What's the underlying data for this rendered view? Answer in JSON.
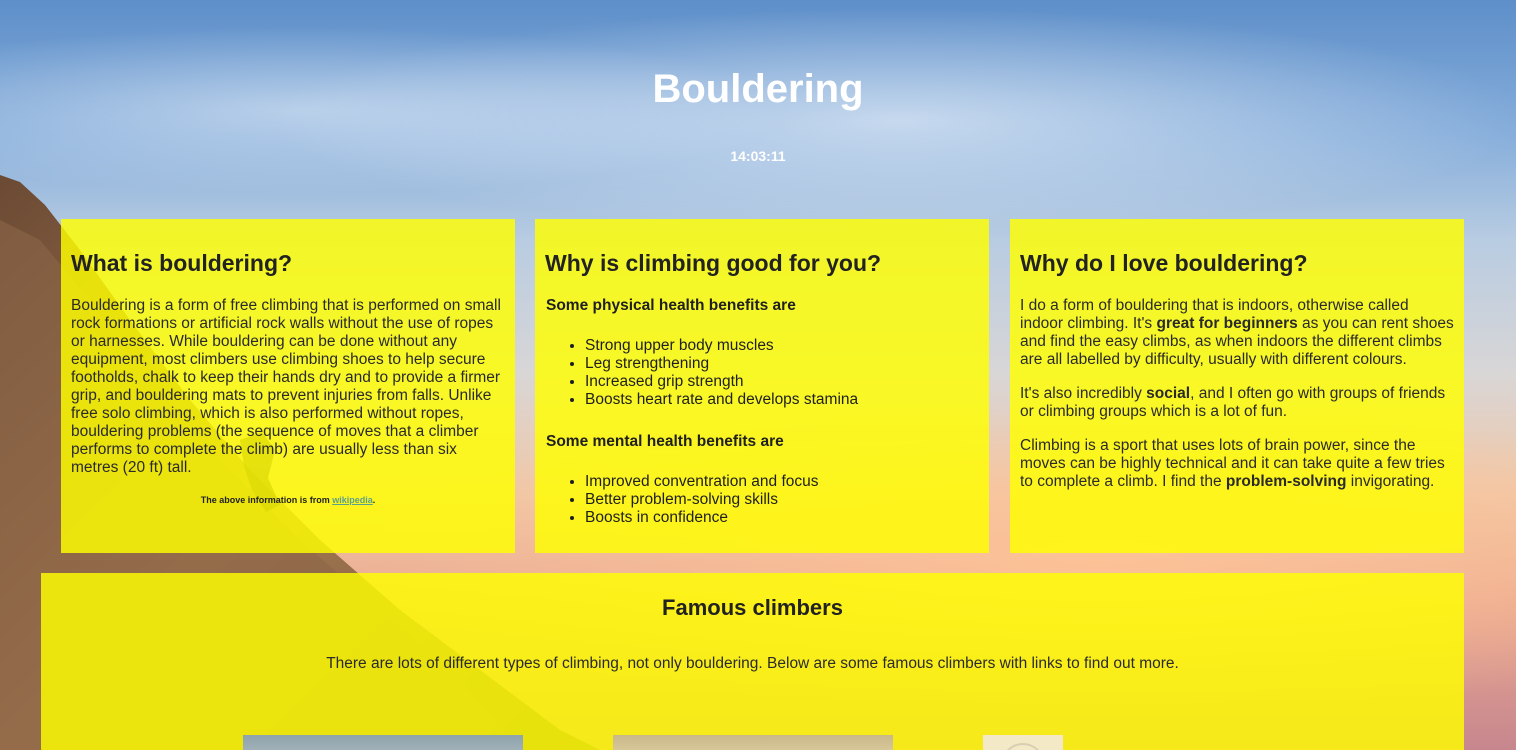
{
  "header": {
    "title": "Bouldering",
    "time": "14:03:11"
  },
  "cards": [
    {
      "heading": "What is bouldering?",
      "paragraph": "Bouldering is a form of free climbing that is performed on small rock formations or artificial rock walls without the use of ropes or harnesses. While bouldering can be done without any equipment, most climbers use climbing shoes to help secure footholds, chalk to keep their hands dry and to provide a firmer grip, and bouldering mats to prevent injuries from falls. Unlike free solo climbing, which is also performed without ropes, bouldering problems (the sequence of moves that a climber performs to complete the climb) are usually less than six metres (20 ft) tall.",
      "source_prefix": "The above information is from ",
      "source_link": "wikipedia",
      "source_suffix": "."
    },
    {
      "heading": "Why is climbing good for you?",
      "physical_title": "Some physical health benefits are",
      "physical": [
        "Strong upper body muscles",
        "Leg strengthening",
        "Increased grip strength",
        "Boosts heart rate and develops stamina"
      ],
      "mental_title": "Some mental health benefits are",
      "mental": [
        "Improved conventration and focus",
        "Better problem-solving skills",
        "Boosts in confidence"
      ]
    },
    {
      "heading": "Why do I love bouldering?",
      "p1_a": "I do a form of bouldering that is indoors, otherwise called indoor climbing. It's ",
      "p1_b": "great for beginners",
      "p1_c": " as you can rent shoes and find the easy climbs, as when indoors the different climbs are all labelled by difficulty, usually with different colours.",
      "p2_a": "It's also incredibly ",
      "p2_b": "social",
      "p2_c": ", and I often go with groups of friends or climbing groups which is a lot of fun.",
      "p3_a": "Climbing is a sport that uses lots of brain power, since the moves can be highly technical and it can take quite a few tries to complete a climb. I find the ",
      "p3_b": "problem-solving",
      "p3_c": " invigorating."
    }
  ],
  "famous": {
    "heading": "Famous climbers",
    "intro": "There are lots of different types of climbing, not only bouldering. Below are some famous climbers with links to find out more."
  },
  "colors": {
    "card_background": "#ffff00",
    "link": "#5aa08c",
    "heading_text": "#ffffff"
  }
}
